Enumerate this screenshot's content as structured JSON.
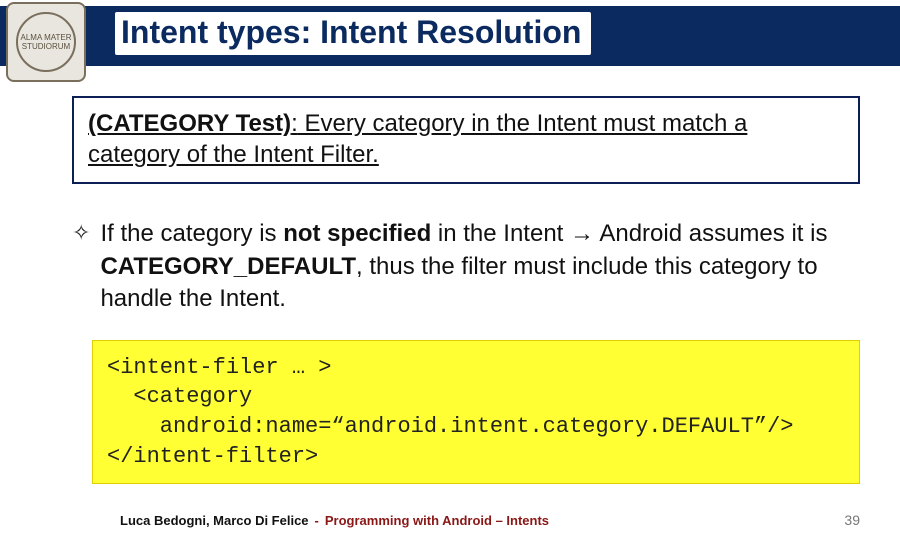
{
  "header": {
    "title_pre": "Intent ",
    "title_accent": "types:",
    "title_post": " Intent Resolution",
    "seal_text": "ALMA MATER STUDIORUM"
  },
  "rule": {
    "label": "(CATEGORY Test)",
    "colon": ":",
    "text": "  Every category in the Intent must match a category of the Intent Filter."
  },
  "bullet": {
    "mark": "✧",
    "part1": "If  the category is ",
    "bold1": "not specified",
    "part2": " in the Intent ",
    "arrow": "→",
    "part3": " Android assumes it is ",
    "bold2": "CATEGORY_DEFAULT",
    "part4": ", thus the filter must include this category to handle the Intent."
  },
  "code": {
    "line1": "<intent-filer … >",
    "line2": "  <category",
    "line3": "    android:name=“android.intent.category.DEFAULT”/>",
    "line4": "</intent-filter>"
  },
  "footer": {
    "authors": "Luca Bedogni, Marco Di Felice",
    "dash": "-",
    "course": "Programming with Android – Intents",
    "page": "39"
  }
}
